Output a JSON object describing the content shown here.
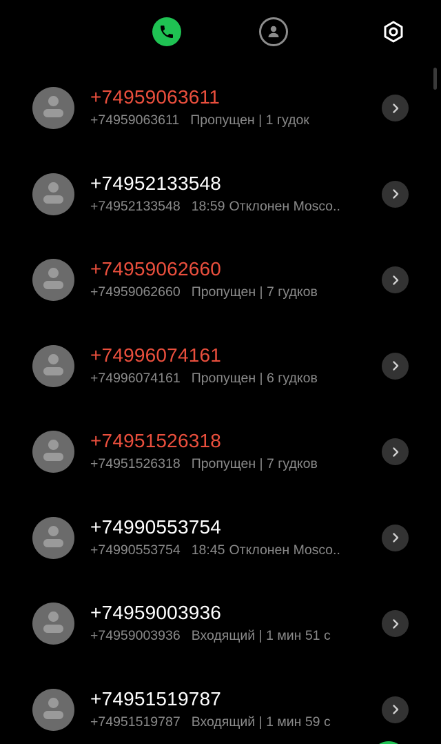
{
  "tabs": {
    "calls_icon": "phone-icon",
    "contacts_icon": "person-icon",
    "settings_icon": "gear-icon",
    "accent": "#1fc253"
  },
  "colors": {
    "missed": "#ea4f3d",
    "normal": "#ffffff",
    "secondary": "#8a8a8a"
  },
  "calls": [
    {
      "name": "+74959063611",
      "number": "+74959063611",
      "time": "",
      "status": "Пропущен | 1 гудок",
      "missed": true
    },
    {
      "name": "+74952133548",
      "number": "+74952133548",
      "time": "18:59",
      "status": "Отклонен  Mosco..",
      "missed": false
    },
    {
      "name": "+74959062660",
      "number": "+74959062660",
      "time": "",
      "status": "Пропущен | 7 гудков",
      "missed": true
    },
    {
      "name": "+74996074161",
      "number": "+74996074161",
      "time": "",
      "status": "Пропущен | 6 гудков",
      "missed": true
    },
    {
      "name": "+74951526318",
      "number": "+74951526318",
      "time": "",
      "status": "Пропущен | 7 гудков",
      "missed": true
    },
    {
      "name": "+74990553754",
      "number": "+74990553754",
      "time": "18:45",
      "status": "Отклонен  Mosco..",
      "missed": false
    },
    {
      "name": "+74959003936",
      "number": "+74959003936",
      "time": "",
      "status": "Входящий | 1 мин 51 с",
      "missed": false
    },
    {
      "name": "+74951519787",
      "number": "+74951519787",
      "time": "",
      "status": "Входящий | 1 мин 59 с",
      "missed": false
    }
  ]
}
